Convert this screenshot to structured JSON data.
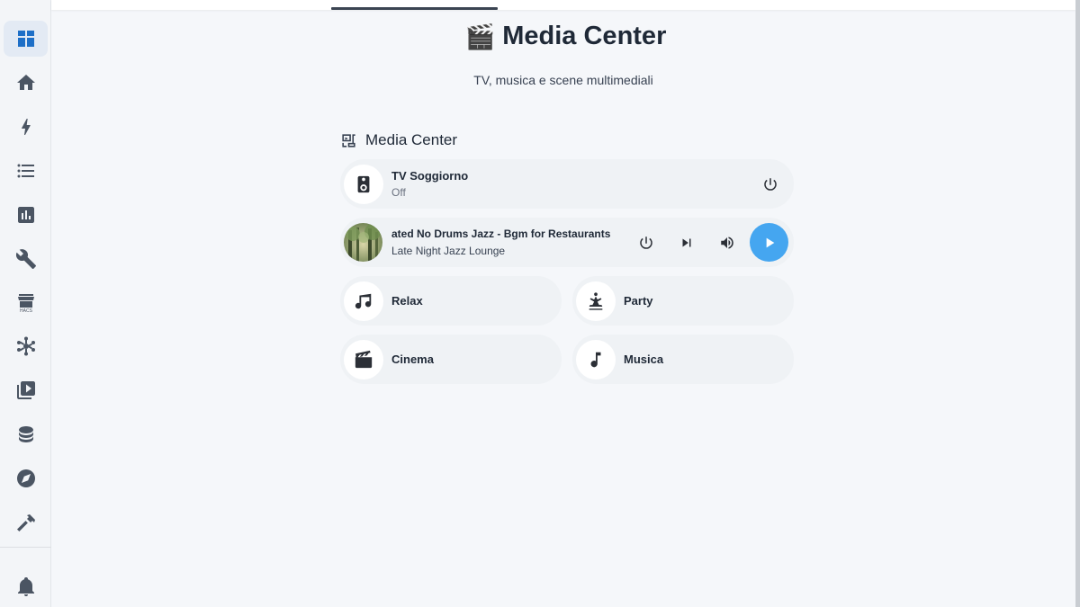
{
  "sidebar": {
    "items": [
      {
        "name": "dashboard",
        "icon": "view-dashboard-icon",
        "active": true
      },
      {
        "name": "home",
        "icon": "home-icon",
        "active": false
      },
      {
        "name": "energy",
        "icon": "lightning-bolt-icon",
        "active": false
      },
      {
        "name": "logbook",
        "icon": "format-list-bulleted-icon",
        "active": false
      },
      {
        "name": "history",
        "icon": "chart-box-icon",
        "active": false
      },
      {
        "name": "settings",
        "icon": "wrench-icon",
        "active": false
      },
      {
        "name": "hacs",
        "icon": "hacs-store-icon",
        "active": false
      },
      {
        "name": "zigbee",
        "icon": "zigbee-network-icon",
        "active": false
      },
      {
        "name": "media",
        "icon": "play-box-multiple-icon",
        "active": false
      },
      {
        "name": "database",
        "icon": "database-icon",
        "active": false
      },
      {
        "name": "explore",
        "icon": "compass-icon",
        "active": false
      },
      {
        "name": "developer-tools",
        "icon": "hammer-icon",
        "active": false
      }
    ],
    "notifications_icon": "bell-icon"
  },
  "header": {
    "title_emoji": "🎬",
    "title": "Media Center",
    "subtitle": "TV, musica e scene multimediali"
  },
  "section": {
    "title": "Media Center",
    "icon": "multimedia-icon"
  },
  "tv": {
    "name": "TV Soggiorno",
    "state": "Off",
    "icon": "speaker-icon",
    "power_icon": "power-icon"
  },
  "media_player": {
    "title": "ated No Drums Jazz - Bgm for Restaurants",
    "artist": "Late Night Jazz Lounge",
    "controls": [
      "power-icon",
      "skip-next-icon",
      "volume-high-icon",
      "play-icon"
    ],
    "accent_color": "#45a6f0"
  },
  "scenes": [
    {
      "label": "Relax",
      "icon": "music-notes-icon"
    },
    {
      "label": "Party",
      "icon": "party-dancer-icon"
    },
    {
      "label": "Cinema",
      "icon": "movie-clapperboard-icon"
    },
    {
      "label": "Musica",
      "icon": "music-note-icon"
    }
  ],
  "colors": {
    "background": "#f5f7fa",
    "card": "#eff2f5",
    "sidebar_active": "#1e6fc7"
  }
}
